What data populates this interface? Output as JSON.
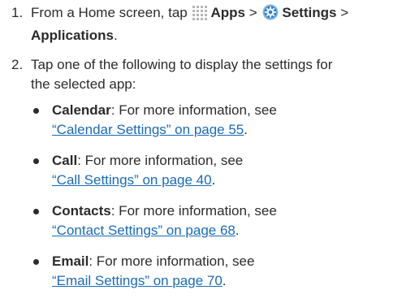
{
  "step1": {
    "number": "1.",
    "prefix": "From a Home screen, tap",
    "apps_label": "Apps",
    "sep1": ">",
    "settings_label": "Settings",
    "sep2": ">",
    "applications_label": "Applications",
    "end": "."
  },
  "step2": {
    "number": "2.",
    "text_line1": "Tap one of the following to display the settings for",
    "text_line2": "the selected app:"
  },
  "items": [
    {
      "name": "Calendar",
      "desc": ": For more information, see",
      "link": "“Calendar Settings” on page 55",
      "end": "."
    },
    {
      "name": "Call",
      "desc": ": For more information, see",
      "link": "“Call Settings” on page 40",
      "end": "."
    },
    {
      "name": "Contacts",
      "desc": ": For more information, see",
      "link": "“Contact Settings” on page 68",
      "end": "."
    },
    {
      "name": "Email",
      "desc": ": For more information, see",
      "link": "“Email Settings” on page 70",
      "end": "."
    }
  ],
  "colors": {
    "text": "#2b2b2b",
    "link": "#1a6bb5"
  },
  "icons": {
    "apps": "apps-grid-icon",
    "settings": "settings-gear-icon"
  }
}
